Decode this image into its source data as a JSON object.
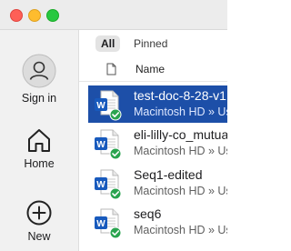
{
  "window": {
    "controls": [
      "close",
      "minimize",
      "zoom"
    ]
  },
  "sidebar": {
    "items": [
      {
        "label": "Sign in",
        "icon": "person-circle-icon"
      },
      {
        "label": "Home",
        "icon": "home-icon"
      },
      {
        "label": "New",
        "icon": "plus-circle-icon"
      }
    ]
  },
  "tabs": {
    "all": "All",
    "pinned": "Pinned",
    "selected": "All"
  },
  "list": {
    "header": {
      "name": "Name"
    },
    "rows": [
      {
        "title": "test-doc-8-28-v1",
        "path": "Macintosh HD » Users",
        "selected": true
      },
      {
        "title": "eli-lilly-co_mutual",
        "path": "Macintosh HD » Users",
        "selected": false
      },
      {
        "title": "Seq1-edited",
        "path": "Macintosh HD » Users",
        "selected": false
      },
      {
        "title": "seq6",
        "path": "Macintosh HD » Users",
        "selected": false
      }
    ]
  },
  "colors": {
    "selection": "#1d4fa8",
    "word_blue": "#185abd",
    "sync_green": "#2aa44f"
  }
}
